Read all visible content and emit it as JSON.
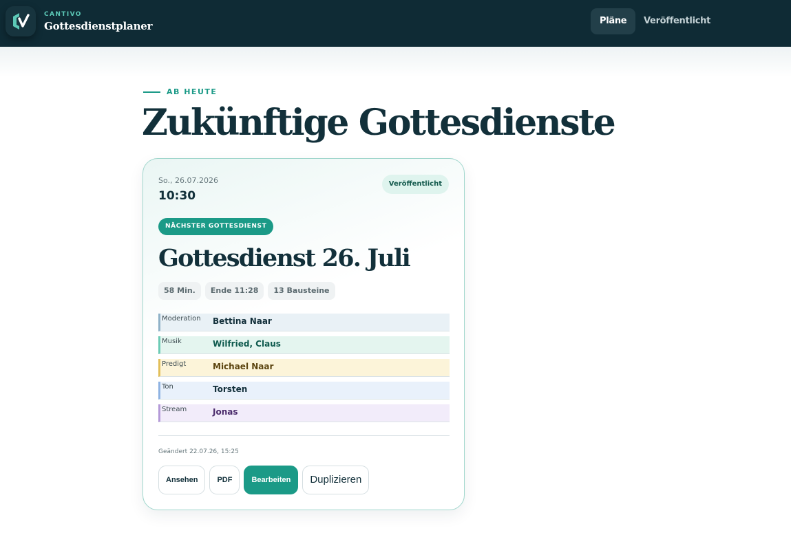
{
  "header": {
    "brand_small": "CANTIVO",
    "brand_title": "Gottesdienstplaner",
    "nav": [
      {
        "label": "Pläne",
        "active": true
      },
      {
        "label": "Veröffentlicht",
        "active": false
      }
    ]
  },
  "page": {
    "eyebrow": "AB HEUTE",
    "title": "Zukünftige Gottesdienste"
  },
  "card": {
    "date": "So., 26.07.2026",
    "time": "10:30",
    "status": "Veröffentlicht",
    "badge": "NÄCHSTER GOTTESDIENST",
    "title": "Gottesdienst 26. Juli",
    "chips": [
      "58 Min.",
      "Ende 11:28",
      "13 Bausteine"
    ],
    "roles": [
      {
        "label": "Moderation",
        "name": "Bettina Naar",
        "bar": "#8fb2c8",
        "bg": "#e9f1f6",
        "color": "#13303b"
      },
      {
        "label": "Musik",
        "name": "Wilfried, Claus",
        "bar": "#6ccbb5",
        "bg": "#e4f5ef",
        "color": "#0f5a4e"
      },
      {
        "label": "Predigt",
        "name": "Michael Naar",
        "bar": "#e2bf5a",
        "bg": "#fcf4d9",
        "color": "#5c4510"
      },
      {
        "label": "Ton",
        "name": "Torsten",
        "bar": "#8fb3e2",
        "bg": "#e9f1fb",
        "color": "#13303b"
      },
      {
        "label": "Stream",
        "name": "Jonas",
        "bar": "#b49ad8",
        "bg": "#f2ecfa",
        "color": "#4a2a6b"
      }
    ],
    "changed": "Geändert 22.07.26, 15:25",
    "actions": {
      "view": "Ansehen",
      "pdf": "PDF",
      "edit": "Bearbeiten",
      "duplicate": "Duplizieren"
    }
  },
  "colors": {
    "accent": "#1b9a87",
    "header_bg": "#0f2b35"
  }
}
